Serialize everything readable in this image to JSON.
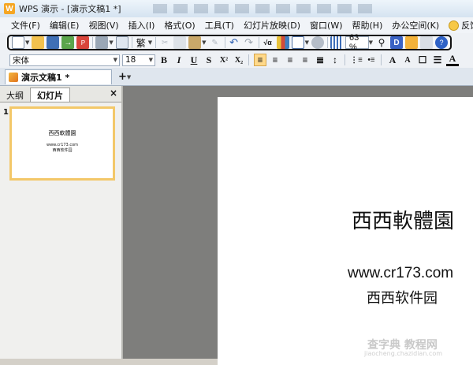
{
  "window": {
    "title": "WPS 演示 - [演示文稿1 *]",
    "logo_letter": "W"
  },
  "menu": {
    "items": [
      "文件(F)",
      "编辑(E)",
      "视图(V)",
      "插入(I)",
      "格式(O)",
      "工具(T)",
      "幻灯片放映(D)",
      "窗口(W)",
      "帮助(H)",
      "办公空间(K)"
    ],
    "feedback": "反馈(B)"
  },
  "toolbar": {
    "zoom": "63 %",
    "icons": [
      "new-icon",
      "open-icon",
      "save-icon",
      "export-icon",
      "pdf-icon",
      "print-icon",
      "preview-icon",
      "traditional-icon",
      "cut-icon",
      "copy-icon",
      "paste-icon",
      "format-painter-icon",
      "undo-icon",
      "redo-icon",
      "formula-icon",
      "chart-icon",
      "table-icon",
      "object-icon",
      "grid-icon",
      "find-icon",
      "design-icon",
      "template-icon",
      "shirt-icon",
      "help-icon"
    ]
  },
  "format_toolbar": {
    "font": "宋体",
    "size": "18",
    "buttons": [
      "B",
      "I",
      "U",
      "S",
      "X²",
      "X₂"
    ]
  },
  "document": {
    "tab_label": "演示文稿1 *"
  },
  "panel": {
    "tabs": [
      "大纲",
      "幻灯片"
    ],
    "close": "×",
    "slide_number": "1"
  },
  "slide": {
    "title": "西西軟體園",
    "url": "www.cr173.com",
    "subtitle": "西西软件园"
  },
  "watermark": {
    "main": "查字典 教程网",
    "small": "jiaocheng.chazidian.com"
  }
}
